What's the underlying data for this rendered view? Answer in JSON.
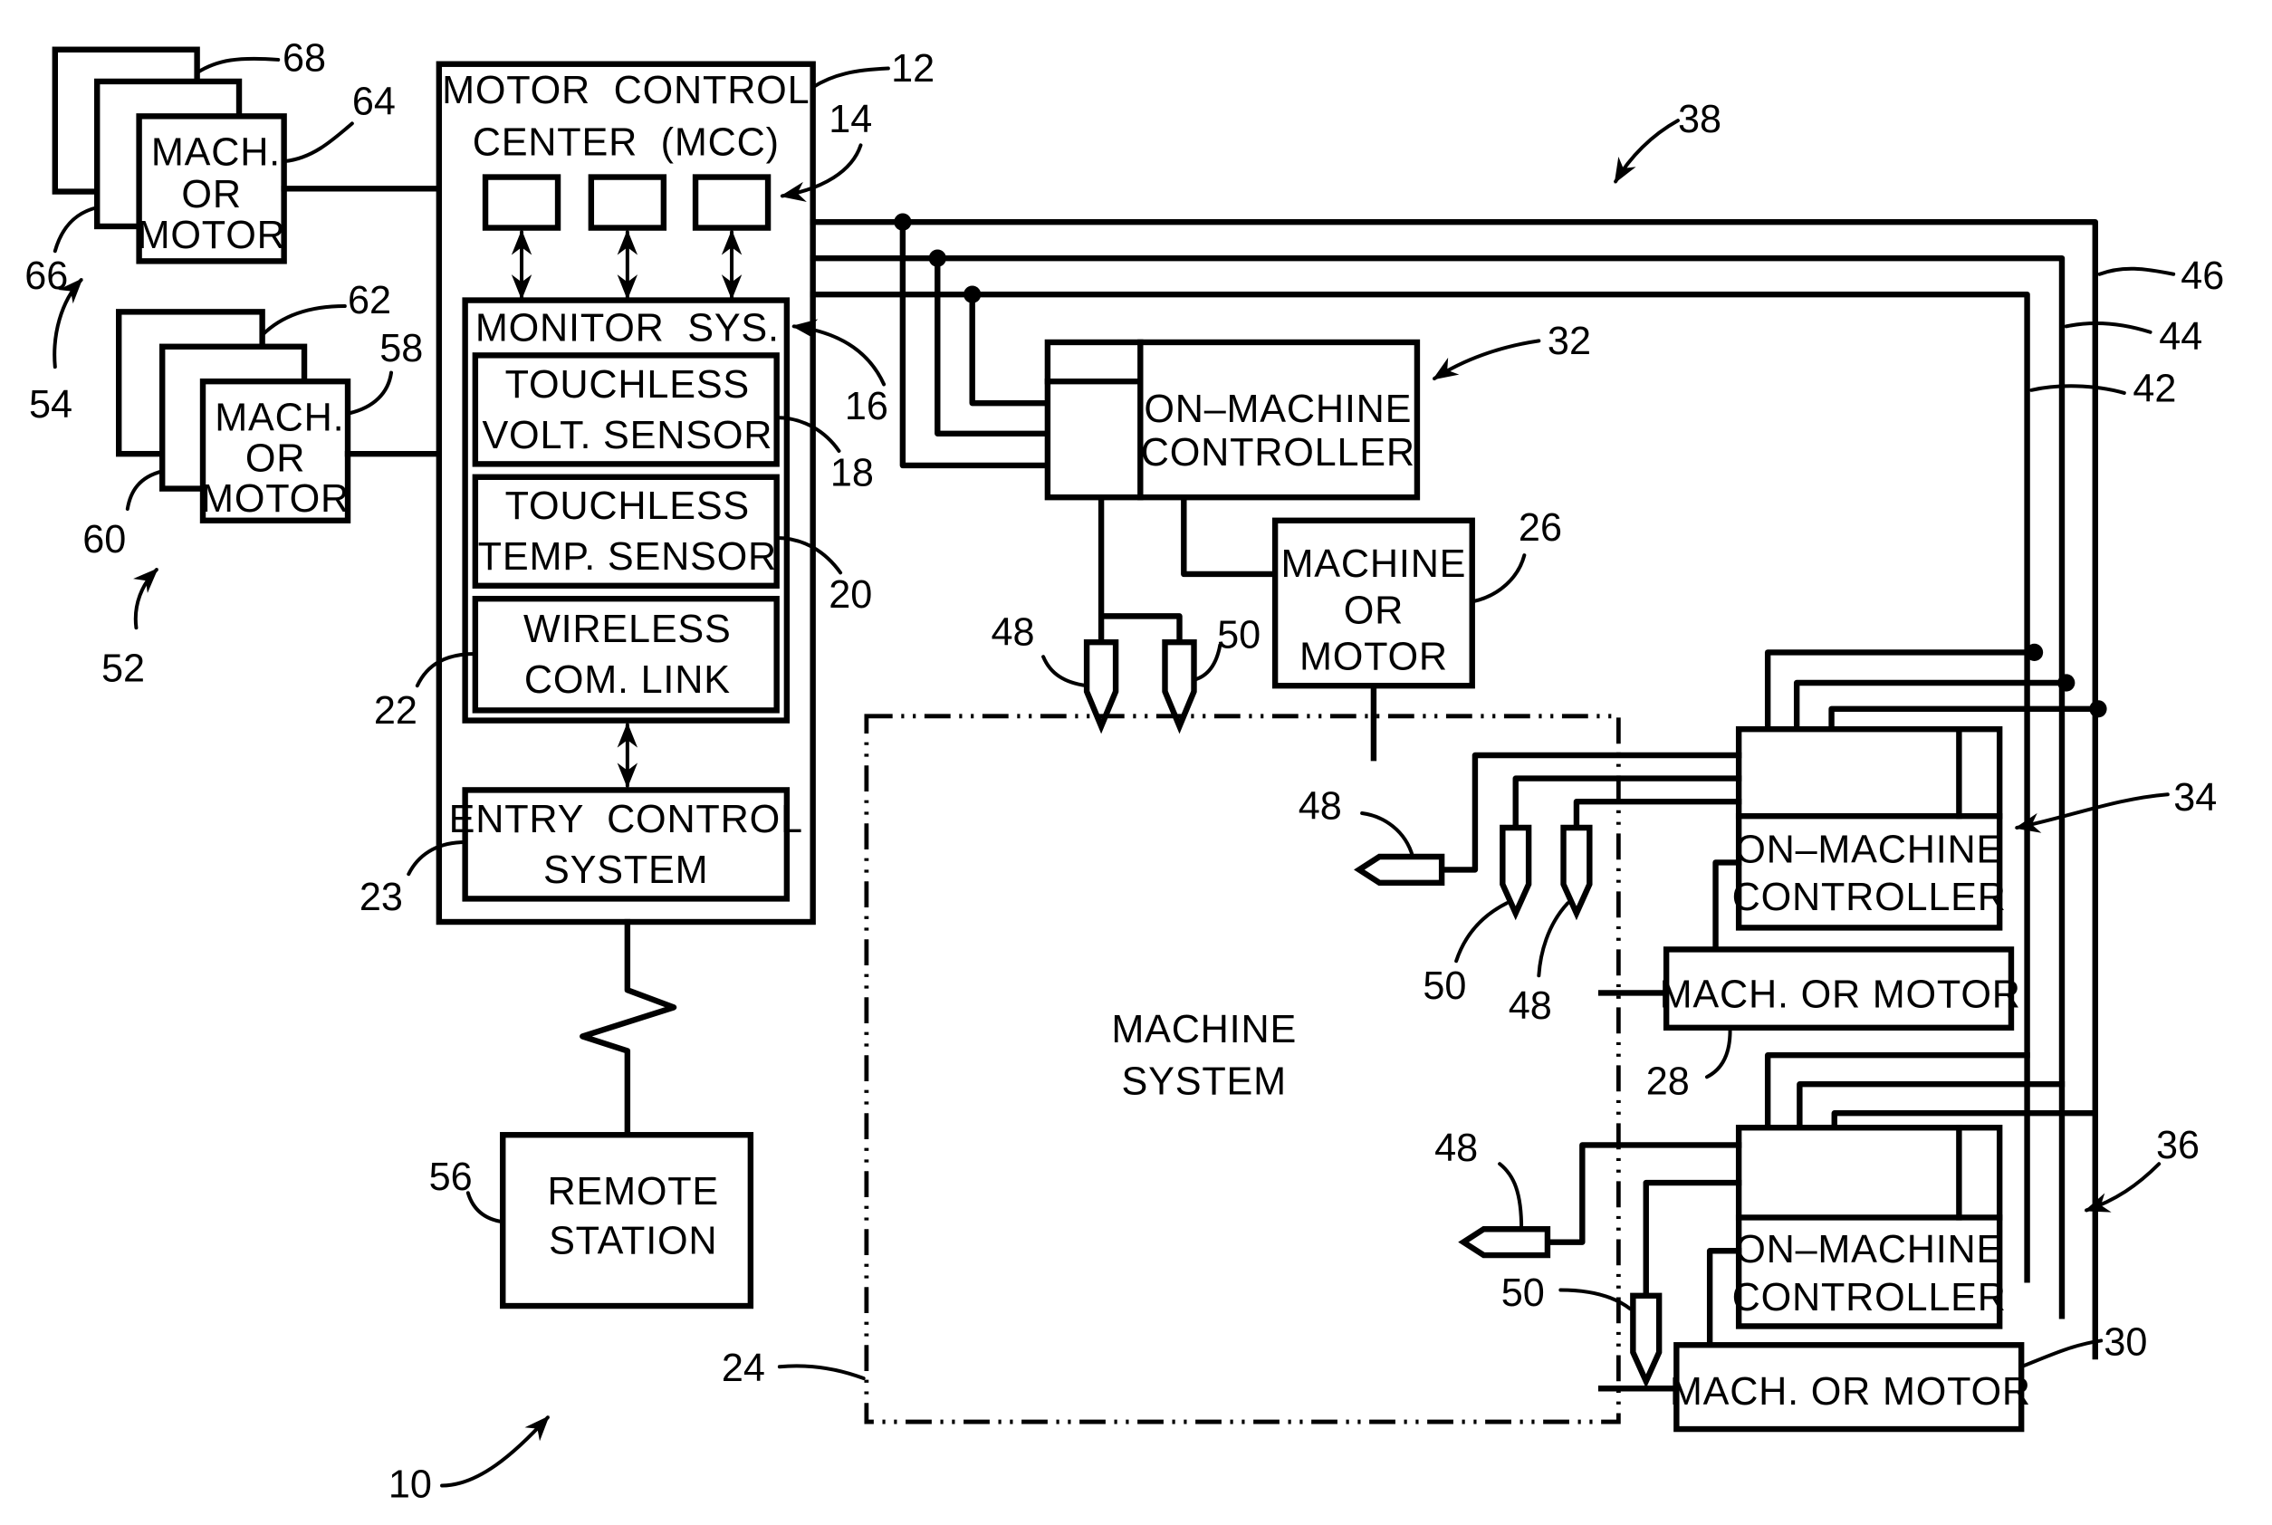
{
  "figure": {
    "title_ref": "10",
    "mcc": {
      "ref": "12",
      "title_line1": "MOTOR  CONTROL",
      "title_line2": "CENTER  (MCC)",
      "units_ref": "14",
      "monitor": {
        "ref": "16",
        "label": "MONITOR  SYS.",
        "volt_sensor": {
          "ref": "18",
          "line1": "TOUCHLESS",
          "line2": "VOLT. SENSOR"
        },
        "temp_sensor": {
          "ref": "20",
          "line1": "TOUCHLESS",
          "line2": "TEMP. SENSOR"
        },
        "wireless": {
          "ref": "22",
          "line1": "WIRELESS",
          "line2": "COM. LINK"
        }
      },
      "entry": {
        "ref": "23",
        "line1": "ENTRY  CONTROL",
        "line2": "SYSTEM"
      }
    },
    "remote_station": {
      "ref": "56",
      "line1": "REMOTE",
      "line2": "STATION"
    },
    "left_groups": [
      {
        "group_ref": "54",
        "stack_ref_back": "68",
        "stack_ref_mid": "66",
        "front_ref": "64",
        "line1": "MACH.",
        "line2": "OR",
        "line3": "MOTOR"
      },
      {
        "group_ref": "52",
        "stack_ref_back": "62",
        "stack_ref_mid": "60",
        "front_ref": "58",
        "line1": "MACH.",
        "line2": "OR",
        "line3": "MOTOR"
      }
    ],
    "network_ref": "38",
    "bus_refs": [
      "46",
      "44",
      "42"
    ],
    "machine_system": {
      "ref": "24",
      "line1": "MACHINE",
      "line2": "SYSTEM"
    },
    "controllers": [
      {
        "ref": "32",
        "line1": "ON–MACHINE",
        "line2": "CONTROLLER"
      },
      {
        "ref": "34",
        "line1": "ON–MACHINE",
        "line2": "CONTROLLER"
      },
      {
        "ref": "36",
        "line1": "ON–MACHINE",
        "line2": "CONTROLLER"
      }
    ],
    "machines": [
      {
        "ref": "26",
        "line1": "MACHINE",
        "line2": "OR",
        "line3": "MOTOR"
      },
      {
        "ref": "28",
        "label": "MACH. OR MOTOR"
      },
      {
        "ref": "30",
        "label": "MACH. OR MOTOR"
      }
    ],
    "sensor_refs": {
      "voltage": "48",
      "temperature": "50"
    }
  }
}
